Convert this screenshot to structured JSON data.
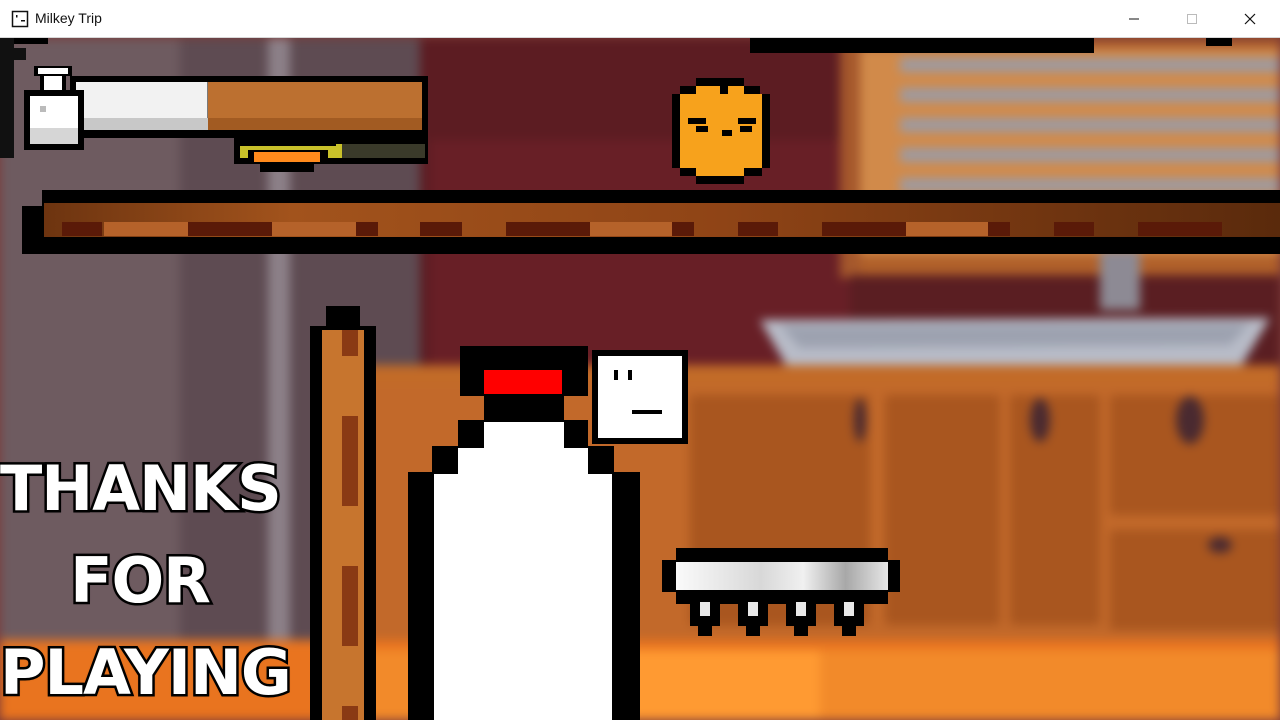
{
  "window": {
    "title": "Milkey Trip",
    "icon": "smiley-box-icon",
    "controls": [
      "minimize-icon",
      "maximize-icon",
      "close-icon"
    ]
  },
  "hud": {
    "milk_icon": "milk-bottle-icon",
    "health_fraction": 0.38,
    "burger_icon": "burger-icon",
    "burger_meter_fraction": 0.55
  },
  "scene": {
    "end_message": [
      "THANKS",
      "FOR",
      "PLAYING"
    ],
    "characters": [
      "orange-blob-enemy",
      "milk-bottle-player",
      "white-cube-friend"
    ],
    "props": [
      "wooden-platform",
      "wooden-post",
      "spiked-metal-platform"
    ]
  },
  "colors": {
    "accent_red": "#ff0000",
    "orange": "#f7a21c",
    "wood": "#9b4a1d",
    "wall": "#6b2226"
  }
}
